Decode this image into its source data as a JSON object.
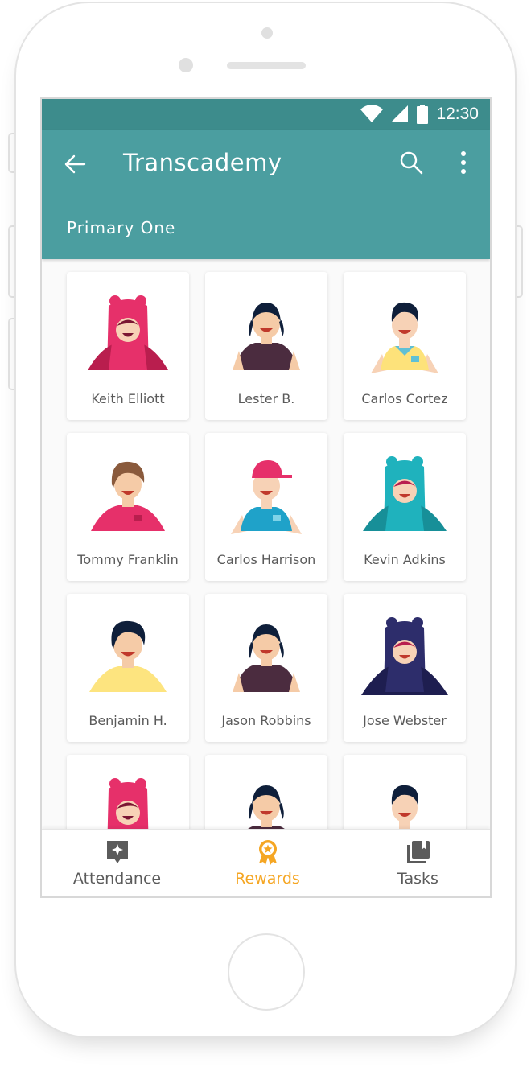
{
  "status_bar": {
    "time": "12:30"
  },
  "app_bar": {
    "title": "Transcademy",
    "subtitle": "Primary One"
  },
  "colors": {
    "primary": "#4b9ea0",
    "status": "#3d8c8c",
    "accent": "#f5a623"
  },
  "students": [
    {
      "name": "Keith Elliott",
      "avatar": "bear-hood-pink"
    },
    {
      "name": "Lester B.",
      "avatar": "girl-dark-shirt"
    },
    {
      "name": "Carlos Cortez",
      "avatar": "boy-yellow-shirt"
    },
    {
      "name": "Tommy Franklin",
      "avatar": "boy-pink-shirt"
    },
    {
      "name": "Carlos Harrison",
      "avatar": "boy-cap-blue-shirt"
    },
    {
      "name": "Kevin Adkins",
      "avatar": "bear-hood-teal"
    },
    {
      "name": "Benjamin H.",
      "avatar": "boy-pale-yellow-shirt"
    },
    {
      "name": "Jason Robbins",
      "avatar": "girl-dark-shirt"
    },
    {
      "name": "Jose Webster",
      "avatar": "bear-hood-navy"
    },
    {
      "name": "",
      "avatar": "bear-hood-pink"
    },
    {
      "name": "",
      "avatar": "girl-dark-shirt"
    },
    {
      "name": "",
      "avatar": "boy-yellow-shirt"
    }
  ],
  "bottom_nav": {
    "items": [
      {
        "label": "Attendance",
        "icon": "attendance-icon",
        "active": false
      },
      {
        "label": "Rewards",
        "icon": "rewards-icon",
        "active": true
      },
      {
        "label": "Tasks",
        "icon": "tasks-icon",
        "active": false
      }
    ]
  }
}
